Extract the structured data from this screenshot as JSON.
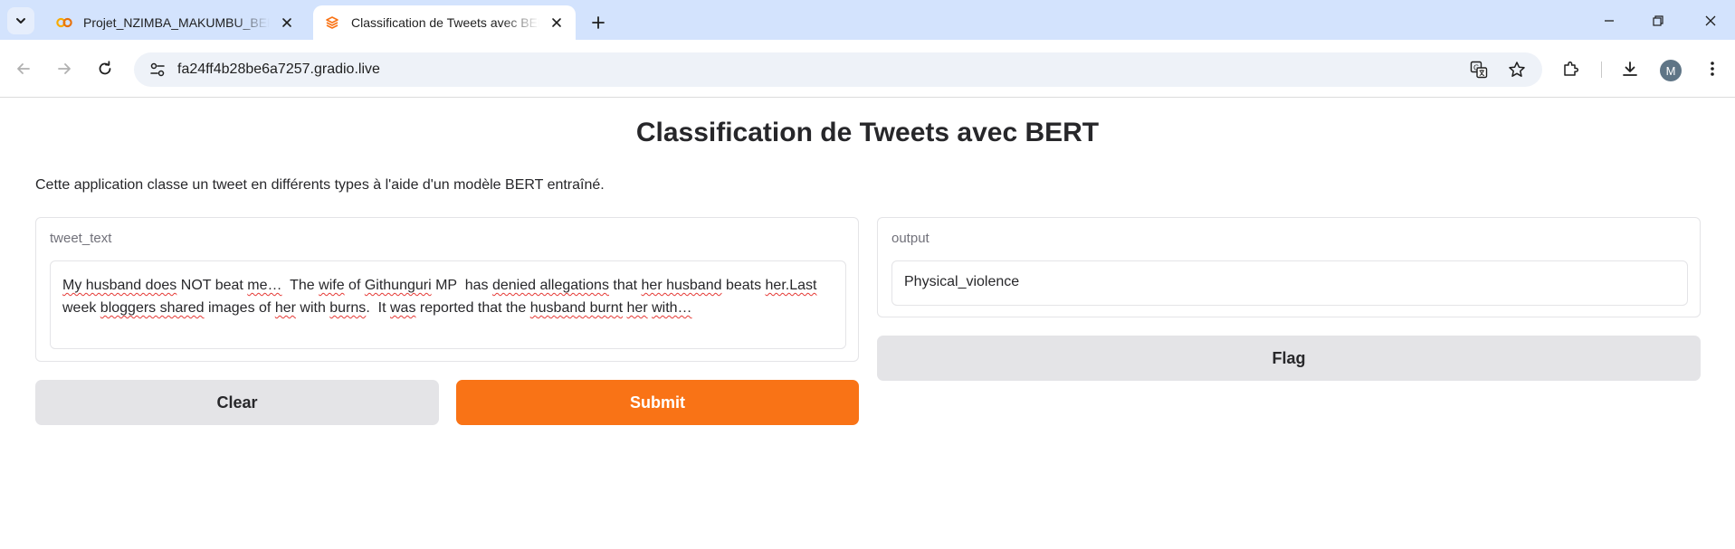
{
  "browser": {
    "tabs": [
      {
        "title": "Projet_NZIMBA_MAKUMBU_BERT",
        "active": false,
        "icon": "colab-icon"
      },
      {
        "title": "Classification de Tweets avec BERT",
        "active": true,
        "icon": "gradio-icon"
      }
    ],
    "url": "fa24ff4b28be6a7257.gradio.live",
    "profile_initial": "M"
  },
  "app": {
    "title": "Classification de Tweets avec BERT",
    "description": "Cette application classe un tweet en différents types à l'aide d'un modèle BERT entraîné.",
    "input": {
      "label": "tweet_text",
      "value_parts": [
        {
          "text": "My husband does",
          "spell": true
        },
        {
          "text": " NOT beat ",
          "spell": false
        },
        {
          "text": "me…",
          "spell": true
        },
        {
          "text": "  The ",
          "spell": false
        },
        {
          "text": "wife",
          "spell": true
        },
        {
          "text": " of ",
          "spell": false
        },
        {
          "text": "Githunguri",
          "spell": true
        },
        {
          "text": " MP  has ",
          "spell": false
        },
        {
          "text": "denied allegations",
          "spell": true
        },
        {
          "text": " that ",
          "spell": false
        },
        {
          "text": "her husband",
          "spell": true
        },
        {
          "text": " beats ",
          "spell": false
        },
        {
          "text": "her.Last",
          "spell": true
        },
        {
          "text": " week ",
          "spell": false
        },
        {
          "text": "bloggers shared",
          "spell": true
        },
        {
          "text": " images of ",
          "spell": false
        },
        {
          "text": "her",
          "spell": true
        },
        {
          "text": " with ",
          "spell": false
        },
        {
          "text": "burns",
          "spell": true
        },
        {
          "text": ".  It ",
          "spell": false
        },
        {
          "text": "was",
          "spell": true
        },
        {
          "text": " reported that the ",
          "spell": false
        },
        {
          "text": "husband burnt",
          "spell": true
        },
        {
          "text": " ",
          "spell": false
        },
        {
          "text": "her",
          "spell": true
        },
        {
          "text": " ",
          "spell": false
        },
        {
          "text": "with…",
          "spell": true
        }
      ]
    },
    "output": {
      "label": "output",
      "value": "Physical_violence"
    },
    "buttons": {
      "clear": "Clear",
      "submit": "Submit",
      "flag": "Flag"
    }
  },
  "colors": {
    "primary": "#f97316",
    "secondary": "#e4e4e7",
    "tabstrip": "#d3e3fd"
  }
}
